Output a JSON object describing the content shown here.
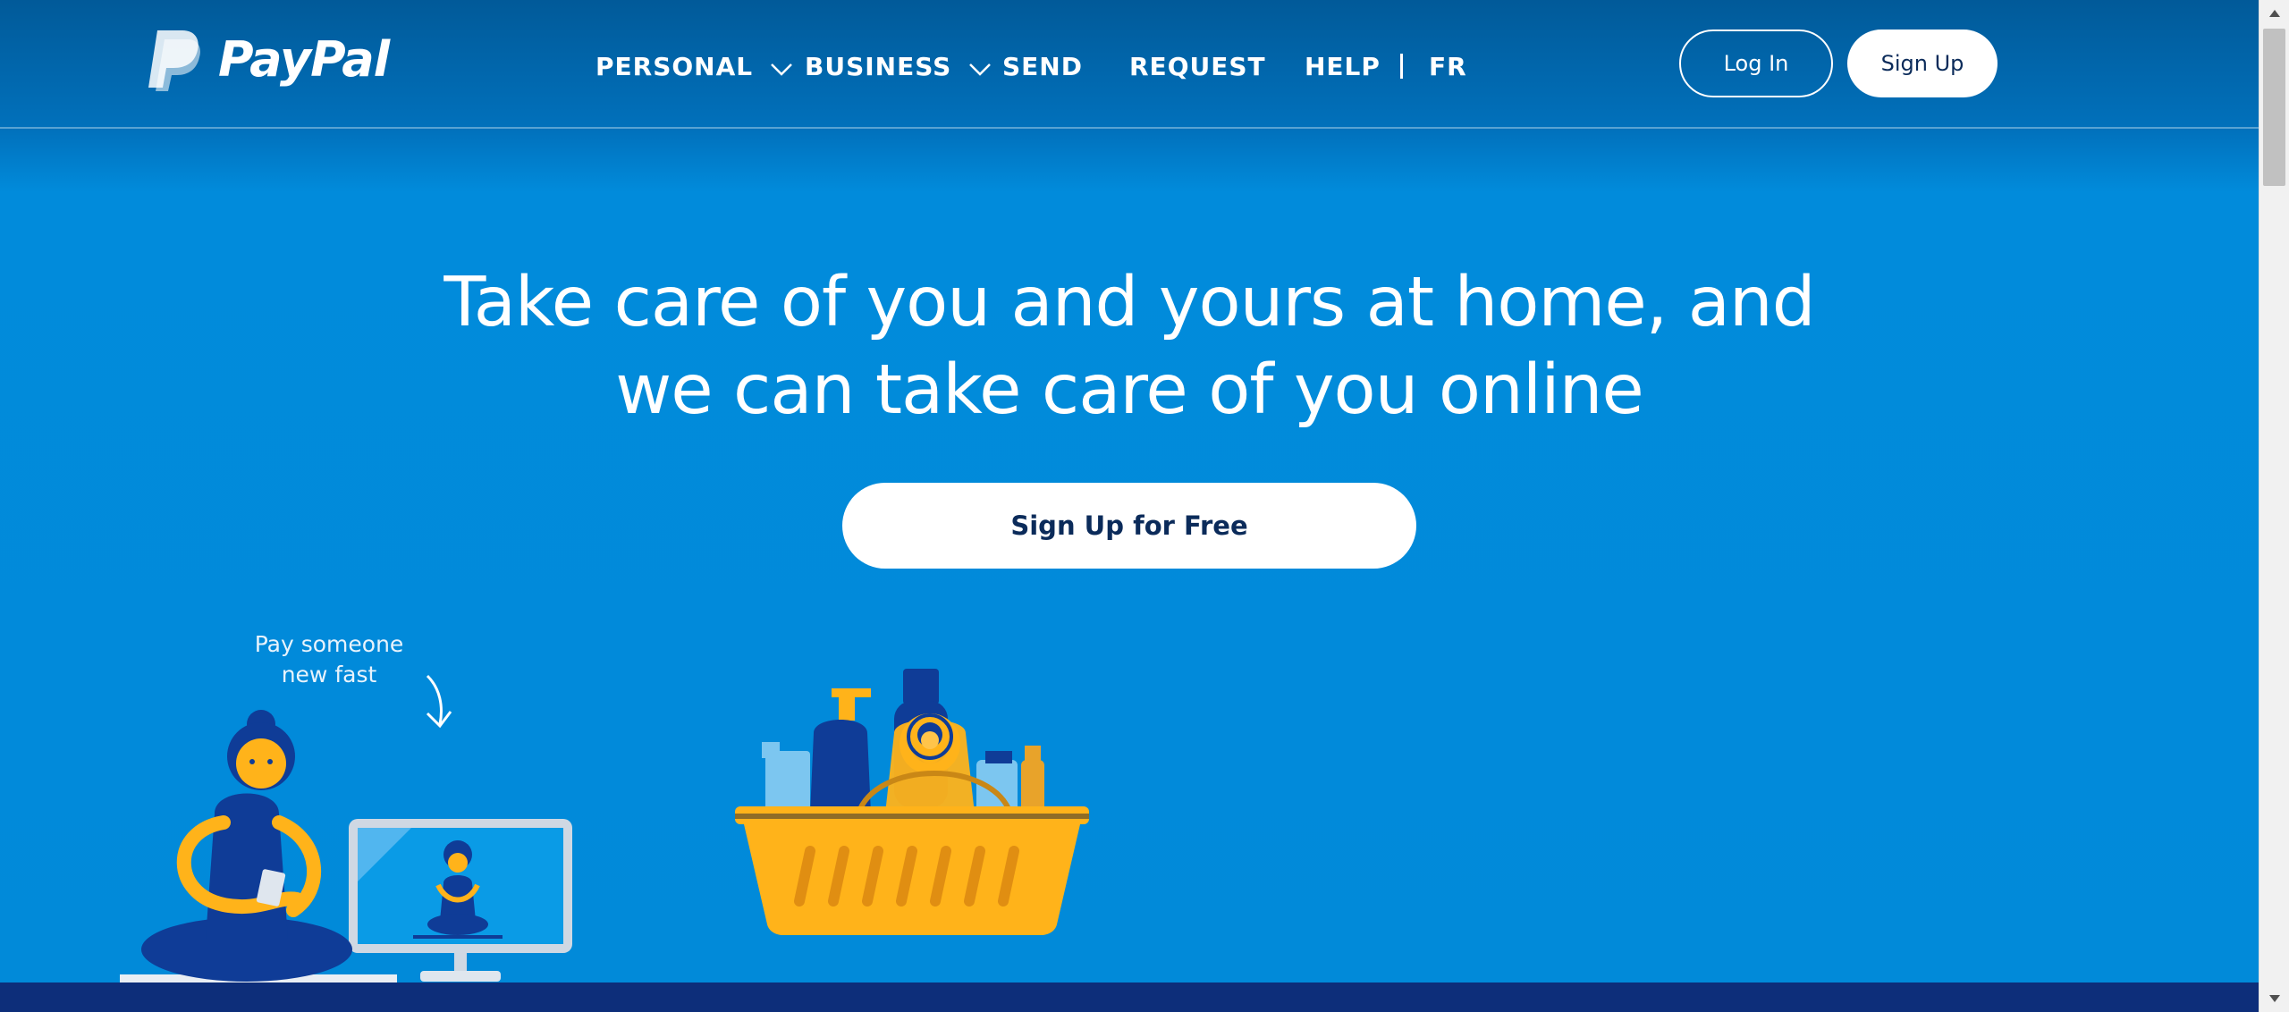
{
  "header": {
    "logo_text": "PayPal",
    "nav": [
      {
        "label": "PERSONAL",
        "has_dropdown": true
      },
      {
        "label": "BUSINESS",
        "has_dropdown": true
      },
      {
        "label": "SEND",
        "has_dropdown": false
      },
      {
        "label": "REQUEST",
        "has_dropdown": false
      },
      {
        "label": "HELP",
        "has_dropdown": false
      },
      {
        "label": "FR",
        "has_dropdown": false
      }
    ],
    "login_label": "Log In",
    "signup_label": "Sign Up"
  },
  "hero": {
    "title_line1": "Take care of you and yours at home, and",
    "title_line2": "we can take care of you online",
    "cta_label": "Sign Up for Free"
  },
  "illustration": {
    "caption": "Pay someone\nnew fast"
  },
  "colors": {
    "header_bg": "#015a99",
    "hero_bg": "#018ad9",
    "footer_band": "#0d2e7a",
    "button_text": "#0b2b5a",
    "illustration_yellow": "#ffb31a",
    "illustration_navy": "#0f3c97"
  },
  "icons": [
    "paypal-logo-icon",
    "chevron-down-icon",
    "scroll-up-arrow-icon",
    "scroll-down-arrow-icon"
  ]
}
